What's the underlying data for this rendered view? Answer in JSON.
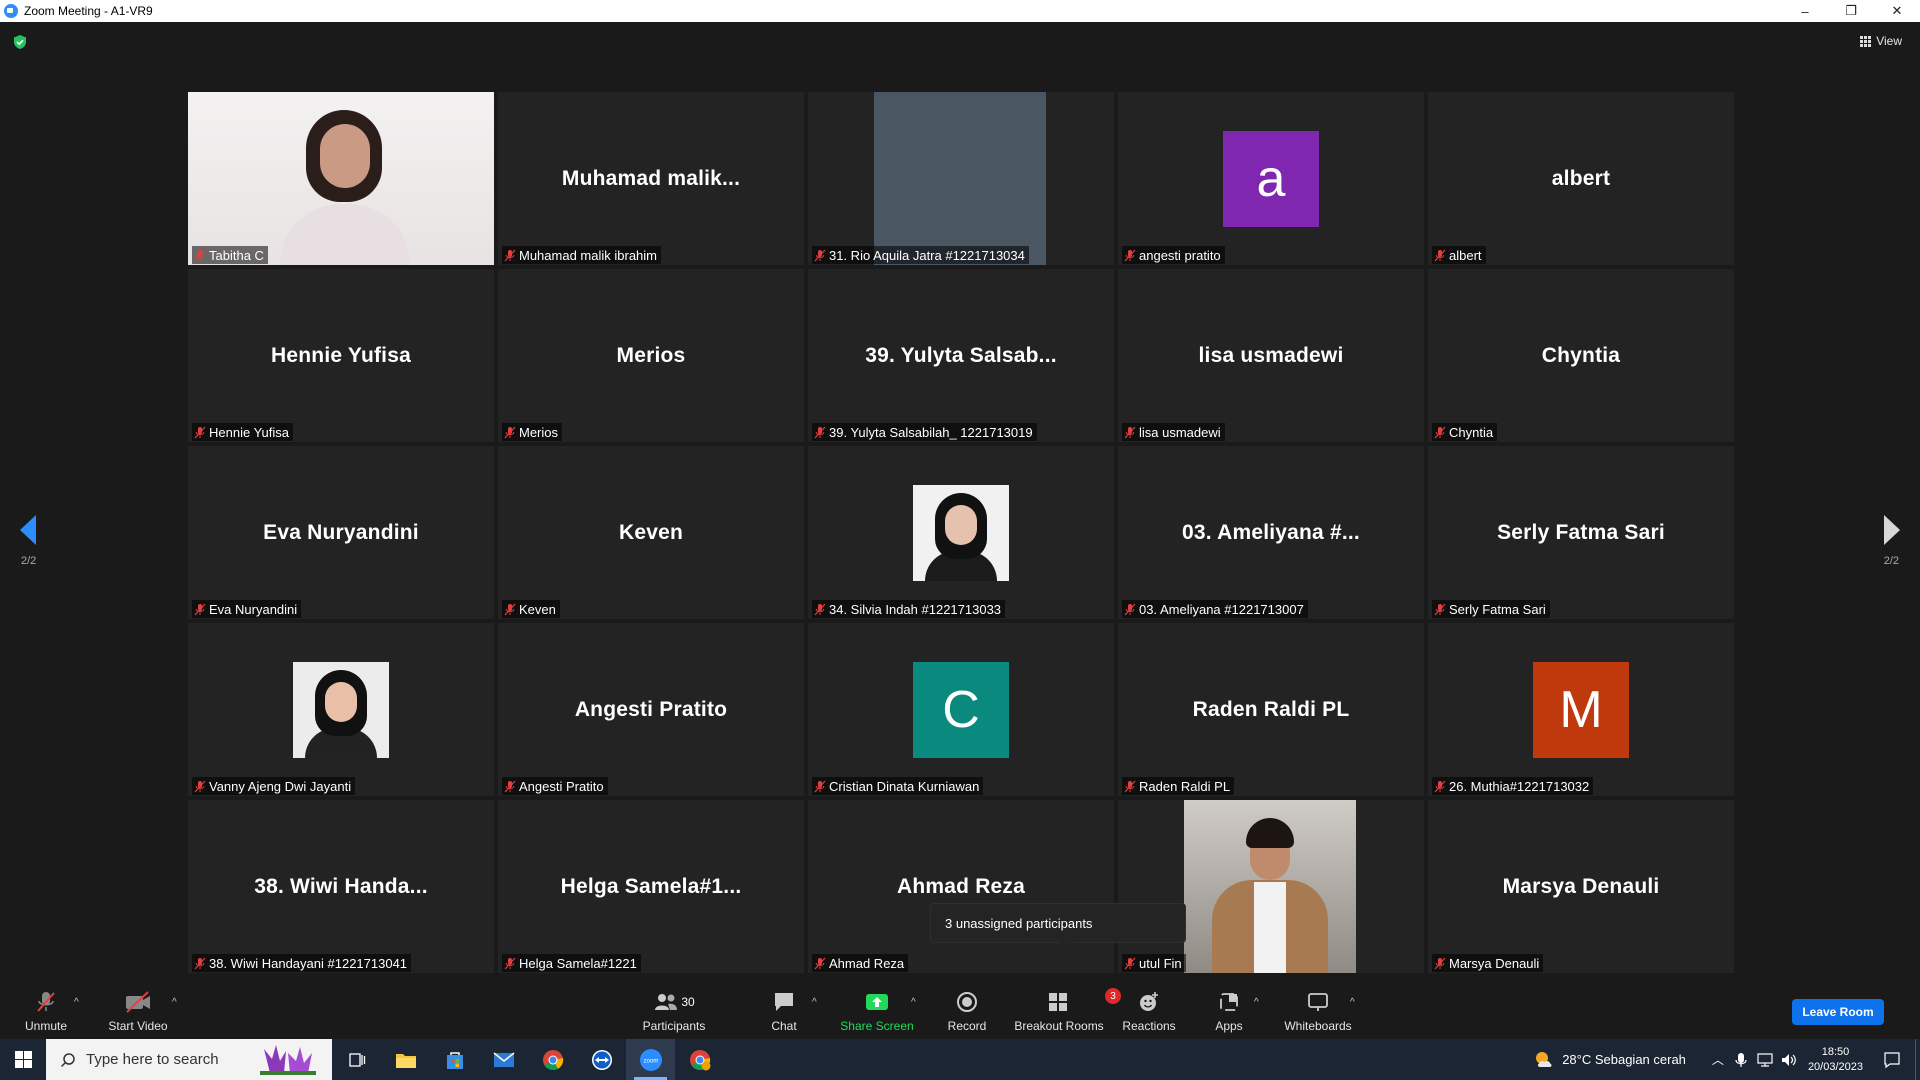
{
  "window": {
    "title": "Zoom Meeting - A1-VR9",
    "minimize": "–",
    "restore": "❐",
    "close": "✕"
  },
  "view_label": "View",
  "page": {
    "left": "2/2",
    "right": "2/2"
  },
  "tiles": [
    {
      "kind": "photo",
      "label": "Tabitha C"
    },
    {
      "kind": "name",
      "big": "Muhamad  malik...",
      "label": "Muhamad malik ibrahim"
    },
    {
      "kind": "gray",
      "label": "31. Rio Aquila Jatra #1221713034"
    },
    {
      "kind": "avatar",
      "letter": "a",
      "color": "#7f27b0",
      "label": "angesti pratito"
    },
    {
      "kind": "name",
      "big": "albert",
      "label": "albert"
    },
    {
      "kind": "name",
      "big": "Hennie Yufisa",
      "label": "Hennie Yufisa"
    },
    {
      "kind": "name",
      "big": "Merios",
      "label": "Merios"
    },
    {
      "kind": "name",
      "big": "39. Yulyta Salsab...",
      "label": "39. Yulyta Salsabilah_ 1221713019"
    },
    {
      "kind": "name",
      "big": "lisa usmadewi",
      "label": "lisa usmadewi"
    },
    {
      "kind": "name",
      "big": "Chyntia",
      "label": "Chyntia"
    },
    {
      "kind": "name",
      "big": "Eva Nuryandini",
      "label": "Eva Nuryandini"
    },
    {
      "kind": "name",
      "big": "Keven",
      "label": "Keven"
    },
    {
      "kind": "smallphoto",
      "label": "34. Silvia Indah #1221713033"
    },
    {
      "kind": "name",
      "big": "03. Ameliyana #...",
      "label": "03. Ameliyana #1221713007"
    },
    {
      "kind": "name",
      "big": "Serly Fatma Sari",
      "label": "Serly Fatma Sari"
    },
    {
      "kind": "smallphoto2",
      "label": "Vanny Ajeng Dwi Jayanti"
    },
    {
      "kind": "name",
      "big": "Angesti Pratito",
      "label": "Angesti Pratito"
    },
    {
      "kind": "avatar",
      "letter": "C",
      "color": "#0a8a7e",
      "label": "Cristian Dinata Kurniawan"
    },
    {
      "kind": "name",
      "big": "Raden Raldi PL",
      "label": "Raden Raldi PL"
    },
    {
      "kind": "avatar",
      "letter": "M",
      "color": "#c0390d",
      "label": "26. Muthia#1221713032"
    },
    {
      "kind": "name",
      "big": "38. Wiwi Handa...",
      "label": "38. Wiwi Handayani #1221713041"
    },
    {
      "kind": "name",
      "big": "Helga  Samela#1...",
      "label": "Helga Samela#1221"
    },
    {
      "kind": "name",
      "big": "Ahmad Reza",
      "label": "Ahmad Reza"
    },
    {
      "kind": "manphoto",
      "label": "utul Fin"
    },
    {
      "kind": "name",
      "big": "Marsya Denauli",
      "label": "Marsya Denauli"
    }
  ],
  "tooltip": "3 unassigned participants",
  "toolbar": {
    "unmute": "Unmute",
    "start_video": "Start Video",
    "participants": "Participants",
    "participants_count": "30",
    "chat": "Chat",
    "share_screen": "Share Screen",
    "record": "Record",
    "breakout_rooms": "Breakout Rooms",
    "breakout_badge": "3",
    "reactions": "Reactions",
    "apps": "Apps",
    "whiteboards": "Whiteboards",
    "leave": "Leave Room",
    "caret": "^"
  },
  "taskbar": {
    "search_placeholder": "Type here to search",
    "weather": "28°C  Sebagian cerah",
    "time": "18:50",
    "date": "20/03/2023"
  },
  "colors": {
    "accent": "#2d8cff",
    "share_green": "#23d959",
    "badge_red": "#e02828",
    "mic_red": "#e53e3e"
  }
}
